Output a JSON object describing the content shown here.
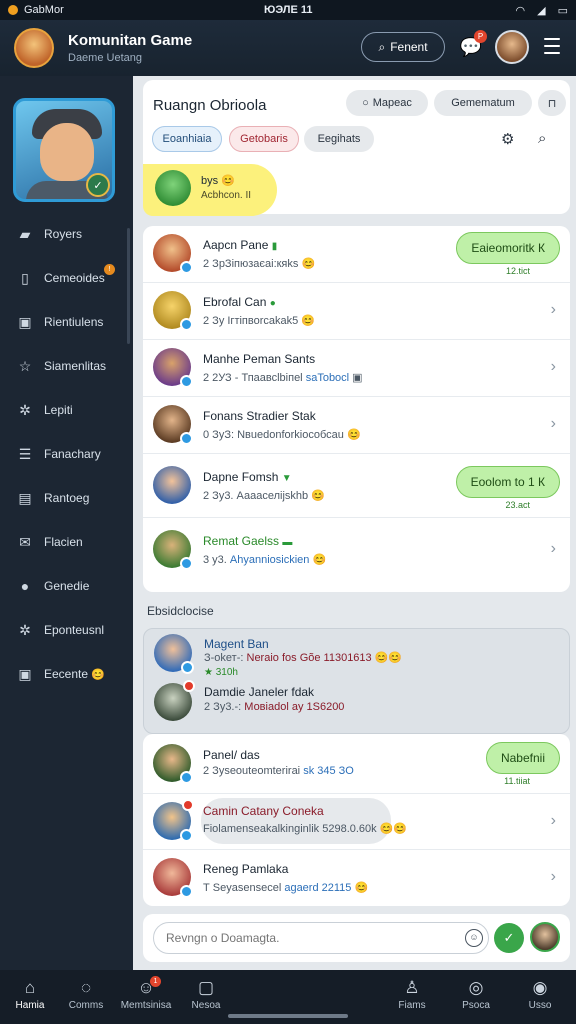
{
  "status_bar": {
    "carrier": "GabMor",
    "time": "ЮЭЛЕ 11"
  },
  "header": {
    "title": "Komunitan Game",
    "subtitle": "Daeme Uetang",
    "search_label": "Fenent",
    "notif_badge": "P"
  },
  "sidebar": {
    "items": [
      {
        "label": "Royers",
        "icon": "folder-icon"
      },
      {
        "label": "Cemeoides",
        "icon": "phone-icon",
        "badge": "!"
      },
      {
        "label": "Rientiulens",
        "icon": "image-icon"
      },
      {
        "label": "Siamenlitas",
        "icon": "star-icon"
      },
      {
        "label": "Lepiti",
        "icon": "gear-icon"
      },
      {
        "label": "Fanachary",
        "icon": "list-icon"
      },
      {
        "label": "Rantoeg",
        "icon": "photo-icon"
      },
      {
        "label": "Flacien",
        "icon": "mail-icon"
      },
      {
        "label": "Genedie",
        "icon": "location-icon"
      },
      {
        "label": "Eponteusnl",
        "icon": "settings-icon"
      },
      {
        "label": "Eecente",
        "icon": "inbox-icon"
      }
    ]
  },
  "room": {
    "title": "Ruangn Obrioola",
    "chip_mapeac": "Mapeac",
    "chip_gamemarum": "Gemematum",
    "tabs": [
      "Eoanhiaia",
      "Getobaris",
      "Eegihats"
    ],
    "highlight": {
      "name": "bys",
      "sub": "Acbhcon. II"
    }
  },
  "chats": [
    {
      "name": "Aapcn Pane",
      "sub": "2 ЗрЗіпюзаєаі:кяks",
      "bubble": "Eaieomoritk К",
      "btime": "12.tict"
    },
    {
      "name": "Ebrofal Can",
      "sub": "2 Зу Ігтіпвоrcakak5",
      "chevron": true
    },
    {
      "name": "Manhe Peman Sants",
      "sub": "2 2УЗ - Тпаавсlbіпеl",
      "link": "saTobocl",
      "chevron": true
    },
    {
      "name": "Fonans Stradier Stak",
      "sub": "0 ЗуЗ: Nвuedonforkiocoбсau",
      "chevron": true
    },
    {
      "name": "Dapne Fomsh",
      "sub": "2 Зу3. Ааааселіjskhb",
      "bubble": "Eoolom to 1 К",
      "btime": "23.act"
    },
    {
      "name": "Remat Gaelss",
      "sub": "3 у3.",
      "link": "Ahyanniosickien",
      "chevron": true
    }
  ],
  "section_label": "Ebsidclocise",
  "group": [
    {
      "name": "Magent Ban",
      "sub": "З-оkет-:",
      "highlight": "Neraio fos Gõe 11301613",
      "extra": "★ 310h"
    },
    {
      "name": "Damdie Janeler fdak",
      "sub": "2 Зу3.-:",
      "highlight": "Мовіаdol аy 1Ѕ6200"
    }
  ],
  "more_chats": [
    {
      "name": "Panel/ das",
      "sub": "2 Зуѕеоuteomteriraі",
      "link": "sk 345 ЗО",
      "bubble": "Nabefnii",
      "btime": "11.tiiat"
    },
    {
      "name": "Camin Catany Coneka",
      "sub": "Fiolamenseakalkinginlik 5298.0.60k",
      "chevron": true
    },
    {
      "name": "Reneg Pamlaka",
      "sub": "Т Seyasensecel",
      "link": "agaerd 22115",
      "chevron": true
    }
  ],
  "composer": {
    "placeholder": "Revngn o Doamagta."
  },
  "bottom_nav": [
    {
      "label": "Hamia",
      "icon": "home-icon",
      "active": true
    },
    {
      "label": "Comms",
      "icon": "chat-icon"
    },
    {
      "label": "Memtsinisa",
      "icon": "group-icon",
      "badge": "1"
    },
    {
      "label": "Nesoa",
      "icon": "square-icon"
    },
    {
      "label": "Fiams",
      "icon": "person-icon"
    },
    {
      "label": "Psoca",
      "icon": "compass-icon"
    },
    {
      "label": "Usso",
      "icon": "settings-icon"
    }
  ],
  "colors": {
    "accent_green": "#3aa64a",
    "badge_red": "#e2452d",
    "bubble_green": "#bff0a8",
    "sidebar": "#1c2633"
  }
}
